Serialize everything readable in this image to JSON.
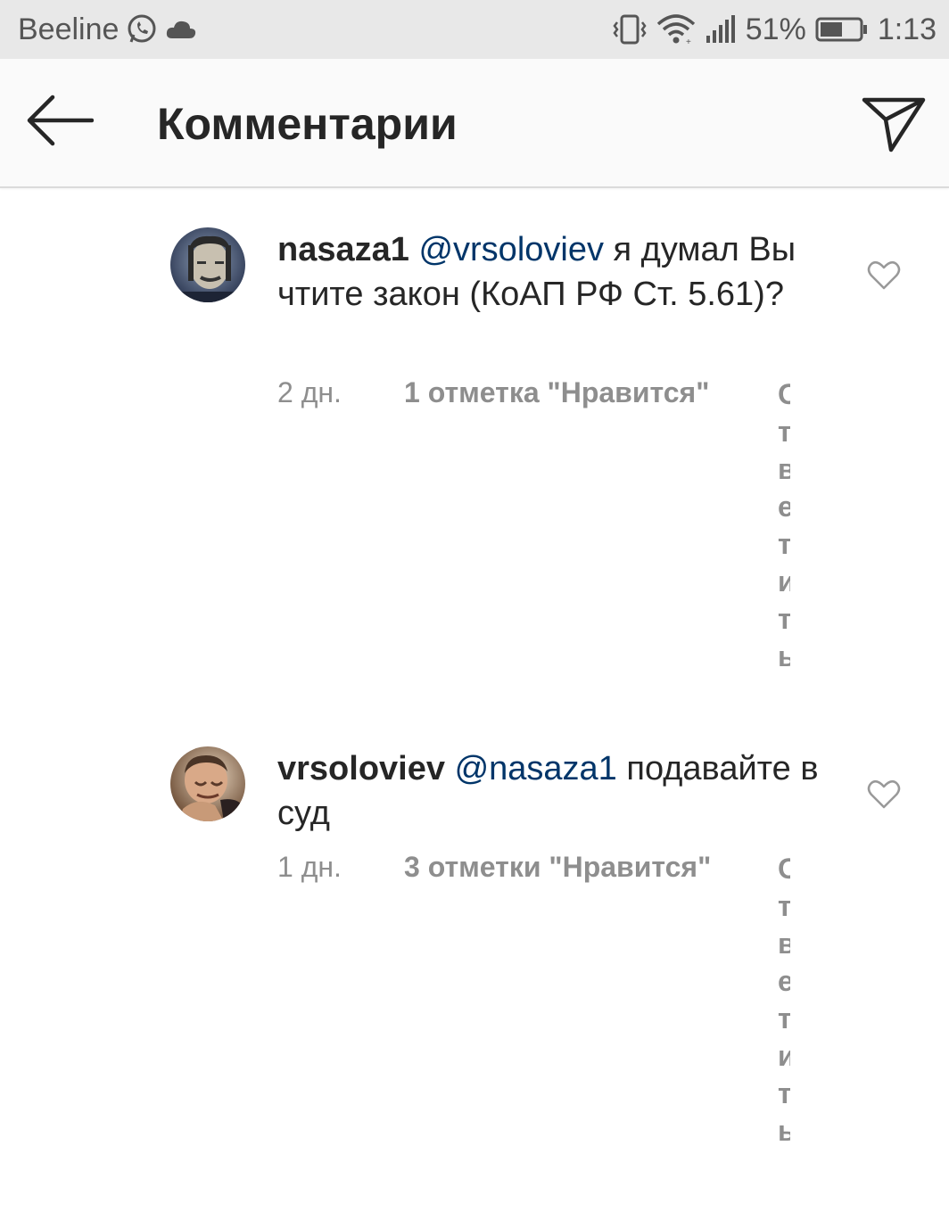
{
  "status_bar": {
    "carrier": "Beeline",
    "battery_percent": "51%",
    "time": "1:13",
    "icons": [
      "whatsapp-icon",
      "cloud-icon",
      "vibrate-icon",
      "wifi-icon",
      "signal-icon",
      "battery-icon"
    ]
  },
  "header": {
    "title": "Комментарии",
    "back_icon": "arrow-left-icon",
    "share_icon": "paper-plane-icon"
  },
  "comments": [
    {
      "username": "nasaza1",
      "mention": "@vrsoloviev",
      "text": " я думал Вы чтите закон (КоАП РФ Ст. 5.61)?",
      "time": "2 дн.",
      "likes": "1 отметка \"Нравится\"",
      "truncated_chars": [
        "О",
        "т",
        "в",
        "е",
        "т",
        "и",
        "т",
        "ь"
      ]
    },
    {
      "username": "vrsoloviev",
      "mention": "@nasaza1",
      "text": " подавайте в суд",
      "time": "1 дн.",
      "likes": "3 отметки \"Нравится\"",
      "truncated_chars": [
        "О",
        "т",
        "в",
        "е",
        "т",
        "и",
        "т",
        "ь"
      ]
    }
  ],
  "colors": {
    "mention": "#003569",
    "meta_gray": "#8e8e8e",
    "status_bar_bg": "#e8e8e8",
    "header_bg": "#fafafa"
  }
}
